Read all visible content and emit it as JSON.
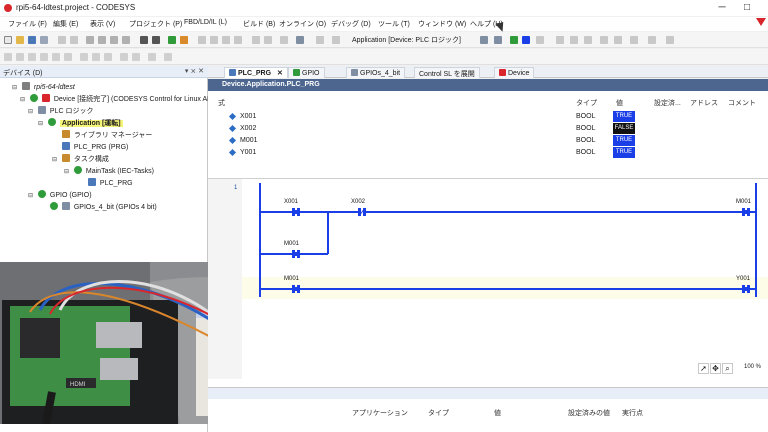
{
  "titlebar": {
    "title": "rpi5-64-ldtest.project - CODESYS",
    "minimize": "─",
    "maximize": "□"
  },
  "menu": [
    "ファイル (F)",
    "編集 (E)",
    "表示 (V)",
    "プロジェクト (P)",
    "FBD/LD/IL (L)",
    "ビルド (B)",
    "オンライン (O)",
    "デバッグ (D)",
    "ツール (T)",
    "ウィンドウ (W)",
    "ヘルプ (H)"
  ],
  "toolbar": {
    "active_application": "Application [Device: PLC ロジック]"
  },
  "devices": {
    "title": "デバイス (D)",
    "buttons": "▾ ⨯ ✕",
    "tree": [
      {
        "label": "rpi5-64-ldtest",
        "icon": "project-icon",
        "expander": "⊟",
        "color": "#7f7f7f"
      },
      {
        "label": "Device [接続完了] (CODESYS Control for Linux ARM",
        "icon": "device-icon",
        "expander": "⊟",
        "color": "#d9262c"
      },
      {
        "label": "PLC ロジック",
        "icon": "plc-logic-icon",
        "expander": "⊟",
        "color": "#7f8ea3"
      },
      {
        "label": "Application [運転]",
        "icon": "application-icon",
        "expander": "⊟",
        "color": "#2f9b3a"
      },
      {
        "label": "ライブラリ マネージャー",
        "icon": "library-icon",
        "expander": "",
        "color": "#c78a2c"
      },
      {
        "label": "PLC_PRG (PRG)",
        "icon": "pou-icon",
        "expander": "",
        "color": "#4a78b8"
      },
      {
        "label": "タスク構成",
        "icon": "task-config-icon",
        "expander": "⊟",
        "color": "#c78a2c"
      },
      {
        "label": "MainTask (IEC-Tasks)",
        "icon": "task-icon",
        "expander": "⊟",
        "color": "#2f9b3a"
      },
      {
        "label": "PLC_PRG",
        "icon": "pou-call-icon",
        "expander": "",
        "color": "#4a78b8"
      },
      {
        "label": "GPIO (GPIO)",
        "icon": "gpio-icon",
        "expander": "⊟",
        "color": "#2f9b3a"
      },
      {
        "label": "GPIOs_4_bit (GPIOs 4 bit)",
        "icon": "gpio-module-icon",
        "expander": "",
        "color": "#7f8ea3"
      }
    ]
  },
  "tabs": [
    {
      "label": "PLC_PRG",
      "close": "✕",
      "icon_color": "#4a78b8"
    },
    {
      "label": "GPIO",
      "close": "",
      "icon_color": "#2f9b3a"
    },
    {
      "label": "GPIOs_4_bit",
      "close": "",
      "icon_color": "#7f8ea3"
    },
    {
      "label": "Control SL を展開",
      "close": "",
      "icon_color": ""
    },
    {
      "label": "Device",
      "close": "",
      "icon_color": "#d9262c"
    }
  ],
  "editor": {
    "path": "Device.Application.PLC_PRG",
    "columns": {
      "expression": "式",
      "type": "タイプ",
      "value": "値",
      "prepared_value": "設定済...",
      "address": "アドレス",
      "comment": "コメント"
    },
    "variables": [
      {
        "name": "X001",
        "type": "BOOL",
        "value": "TRUE",
        "color": "#1a3fe6"
      },
      {
        "name": "X002",
        "type": "BOOL",
        "value": "FALSE",
        "color": "#111111"
      },
      {
        "name": "M001",
        "type": "BOOL",
        "value": "TRUE",
        "color": "#1a3fe6"
      },
      {
        "name": "Y001",
        "type": "BOOL",
        "value": "TRUE",
        "color": "#1a3fe6"
      }
    ]
  },
  "ladder": {
    "network_number": "1",
    "energized_color": "#1a3fe6",
    "labels": {
      "x001": "X001",
      "x002": "X002",
      "m001_seal": "M001",
      "m001_coil": "M001",
      "m001_contact": "M001",
      "y001_coil": "Y001"
    },
    "zoom": "100 %"
  },
  "watch": {
    "columns": {
      "application": "アプリケーション",
      "type": "タイプ",
      "value": "値",
      "prepared": "設定済みの値",
      "execution_point": "実行点"
    }
  },
  "photo": {
    "hdmi_label": "HDMI"
  }
}
